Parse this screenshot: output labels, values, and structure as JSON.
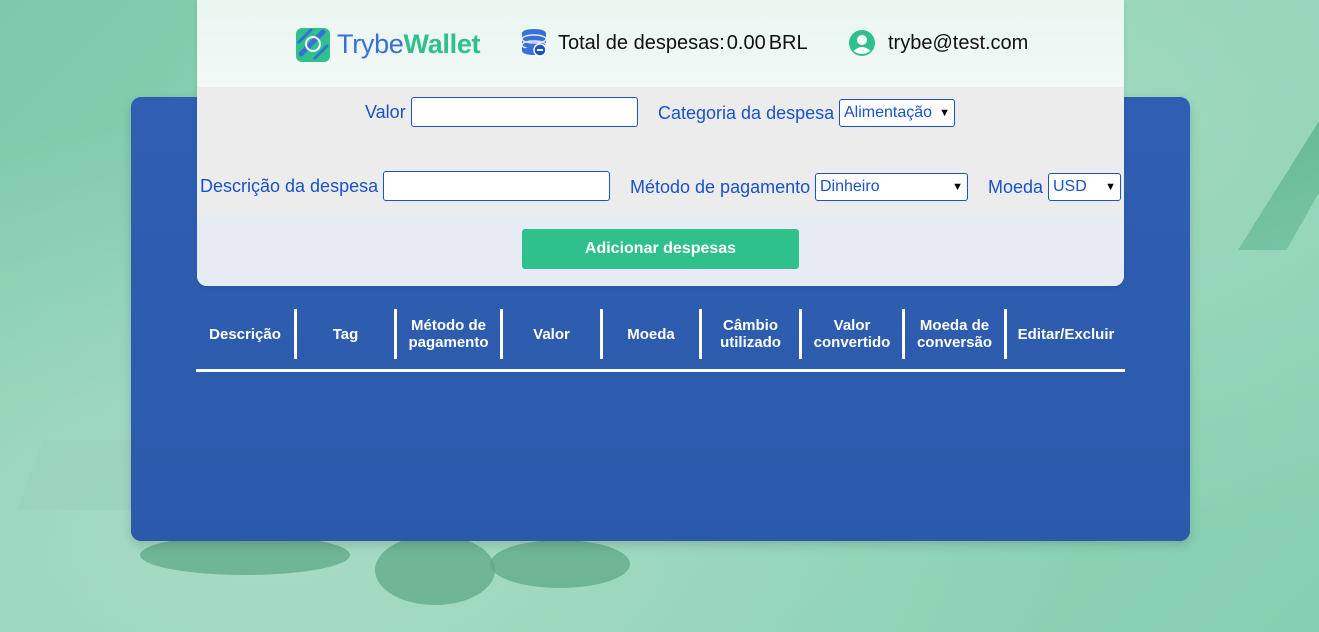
{
  "header": {
    "logo": {
      "text_part1": "Trybe",
      "text_part2": "Wallet",
      "icon": "wallet-logo-icon"
    },
    "total": {
      "label": "Total de despesas:",
      "value": "0.00",
      "currency": "BRL",
      "icon": "coins-icon"
    },
    "user": {
      "email": "trybe@test.com",
      "icon": "user-avatar-icon"
    }
  },
  "form": {
    "value_label": "Valor",
    "value_input": "",
    "category_label": "Categoria da despesa",
    "category_selected": "Alimentação",
    "description_label": "Descrição da despesa",
    "description_input": "",
    "payment_label": "Método de pagamento",
    "payment_selected": "Dinheiro",
    "currency_label": "Moeda",
    "currency_selected": "USD",
    "add_button": "Adicionar despesas"
  },
  "table": {
    "headers": [
      "Descrição",
      "Tag",
      "Método de pagamento",
      "Valor",
      "Moeda",
      "Câmbio utilizado",
      "Valor convertido",
      "Moeda de conversão",
      "Editar/Excluir"
    ],
    "rows": []
  },
  "colors": {
    "accent_green": "#2fc18c",
    "brand_blue": "#1a52c9",
    "card_blue": "#2f5eb3",
    "background_green": "#86cfb0"
  }
}
